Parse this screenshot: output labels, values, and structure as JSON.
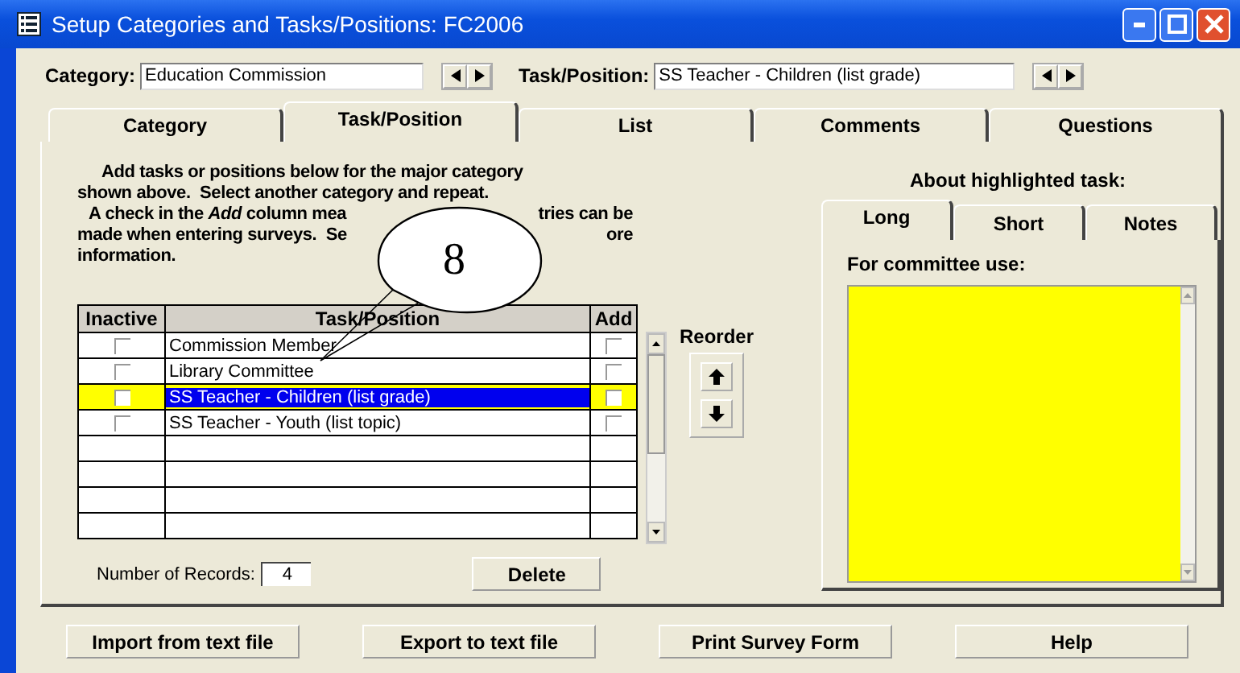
{
  "window": {
    "title": "Setup Categories and Tasks/Positions: FC2006"
  },
  "category": {
    "label": "Category:",
    "value": "Education Commission"
  },
  "task_position": {
    "label": "Task/Position:",
    "value": "SS Teacher - Children (list grade)"
  },
  "tabs": [
    {
      "label": "Category",
      "selected": false
    },
    {
      "label": "Task/Position",
      "selected": true
    },
    {
      "label": "List",
      "selected": false
    },
    {
      "label": "Comments",
      "selected": false
    },
    {
      "label": "Questions",
      "selected": false
    }
  ],
  "instructions": [
    [
      "Add tasks or positions below for the major category"
    ],
    [
      "shown above.  Select another category and repeat."
    ],
    [
      "A check in the *Add* column mea",
      "tries can be"
    ],
    [
      "made when entering surveys.  Se",
      "ore"
    ],
    [
      "information."
    ]
  ],
  "callout": {
    "number": "8"
  },
  "grid": {
    "columns": [
      "Inactive",
      "Task/Position",
      "Add"
    ],
    "rows": [
      {
        "inactive": false,
        "task": "Commission Member",
        "add": false,
        "selected": false
      },
      {
        "inactive": false,
        "task": "Library Committee",
        "add": false,
        "selected": false
      },
      {
        "inactive": false,
        "task": "SS Teacher - Children (list grade)",
        "add": false,
        "selected": true
      },
      {
        "inactive": false,
        "task": "SS Teacher - Youth (list topic)",
        "add": false,
        "selected": false
      }
    ]
  },
  "reorder": {
    "label": "Reorder"
  },
  "about": {
    "heading": "About highlighted task:",
    "tabs": [
      {
        "label": "Long",
        "selected": true
      },
      {
        "label": "Short",
        "selected": false
      },
      {
        "label": "Notes",
        "selected": false
      }
    ],
    "field_label": "For committee use:"
  },
  "records": {
    "label": "Number of Records:",
    "value": "4"
  },
  "delete_button": "Delete",
  "buttons": [
    "Import from text file",
    "Export to text file",
    "Print Survey Form",
    "Help"
  ]
}
